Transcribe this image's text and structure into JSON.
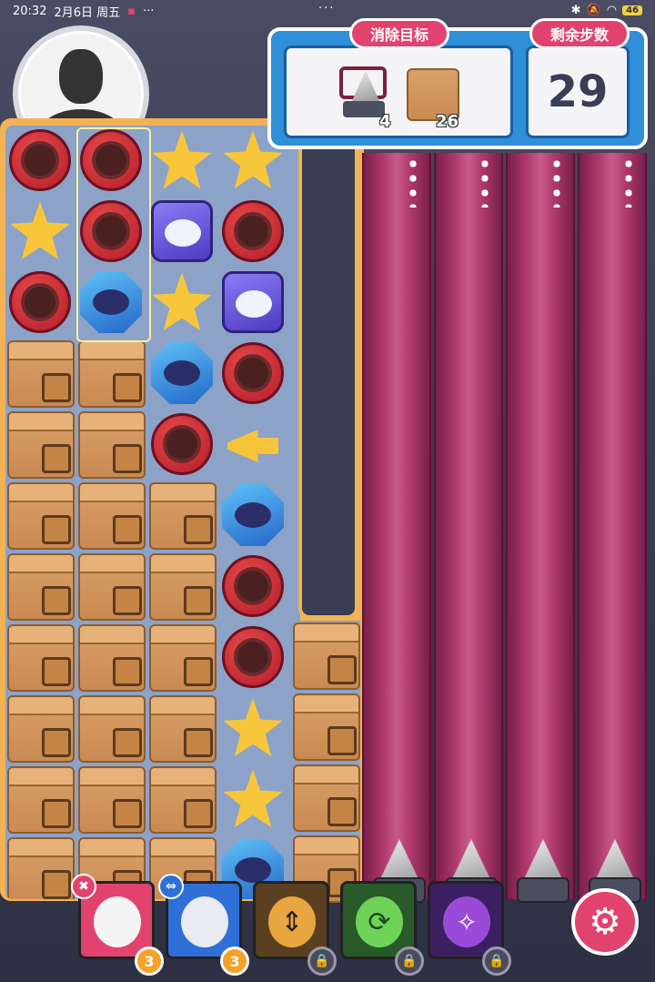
{
  "status_bar": {
    "time": "20:32",
    "date": "2月6日 周五",
    "dots": "···",
    "battery": "46"
  },
  "goal": {
    "title": "消除目标",
    "items": [
      {
        "icon": "drill-icon",
        "count": "4"
      },
      {
        "icon": "crate-icon",
        "count": "26"
      }
    ]
  },
  "steps": {
    "title": "剩余步数",
    "value": "29"
  },
  "skills": [
    {
      "icon": "hero-card-icon",
      "badge": "3",
      "mini": "✖"
    },
    {
      "icon": "hero-card-icon",
      "badge": "3",
      "mini": "⇔"
    },
    {
      "icon": "vertical-swap-icon",
      "locked": true
    },
    {
      "icon": "refresh-icon",
      "locked": true
    },
    {
      "icon": "magic-icon",
      "locked": true
    }
  ],
  "lock_glyph": "🔒",
  "colors": {
    "accent_pink": "#e2436e",
    "panel_blue": "#2f8fd8",
    "board_orange": "#f3b254"
  }
}
